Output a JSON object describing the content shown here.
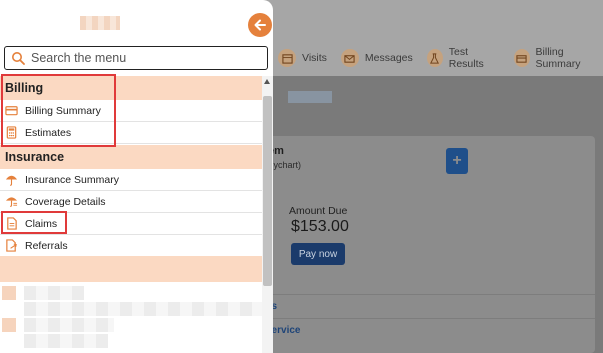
{
  "background": {
    "nav": [
      {
        "label": "Visits",
        "icon": "calendar-icon"
      },
      {
        "label": "Messages",
        "icon": "envelope-icon"
      },
      {
        "label": "Test Results",
        "icon": "flask-icon"
      },
      {
        "label": "Billing Summary",
        "icon": "credit-card-icon"
      }
    ],
    "card": {
      "title": "em",
      "subtitle": "Mychart)",
      "amount_label": "Amount Due",
      "amount": "$153.00",
      "pay_button": "Pay now",
      "link_1": "ils",
      "link_2": "service"
    }
  },
  "menu": {
    "search_placeholder": "Search the menu",
    "sections": [
      {
        "title": "Billing",
        "items": [
          {
            "label": "Billing Summary",
            "icon": "credit-card-icon"
          },
          {
            "label": "Estimates",
            "icon": "calculator-icon"
          }
        ]
      },
      {
        "title": "Insurance",
        "items": [
          {
            "label": "Insurance Summary",
            "icon": "umbrella-icon"
          },
          {
            "label": "Coverage Details",
            "icon": "umbrella-details-icon"
          },
          {
            "label": "Claims",
            "icon": "document-icon"
          },
          {
            "label": "Referrals",
            "icon": "referral-icon"
          }
        ]
      }
    ]
  },
  "colors": {
    "accent": "#e5813c",
    "section_bg": "#fbd9c2",
    "highlight": "#e03a3a",
    "link": "#1e4478"
  }
}
